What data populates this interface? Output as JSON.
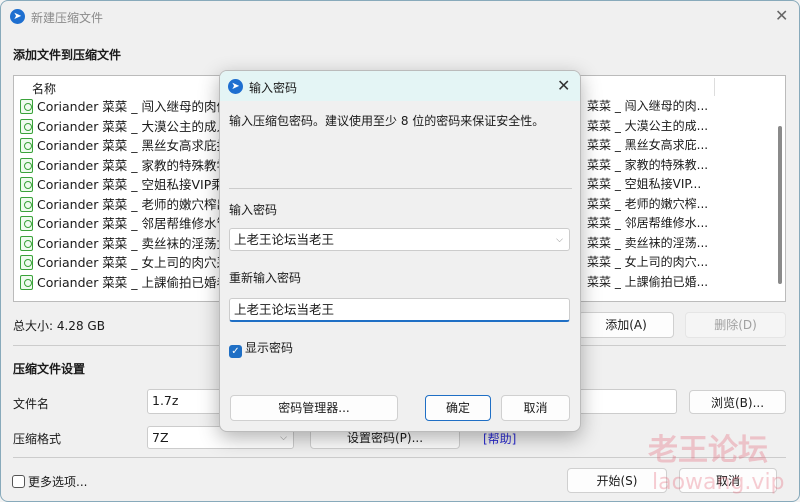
{
  "main": {
    "title": "新建压缩文件",
    "section_add": "添加文件到压缩文件",
    "column_name": "名称",
    "files": [
      {
        "name": "Coriander 菜菜 _ 闯入继母的肉体",
        "col2": "菜菜 _ 闯入继母的肉..."
      },
      {
        "name": "Coriander 菜菜 _ 大漠公主的成人",
        "col2": "菜菜 _ 大漠公主的成..."
      },
      {
        "name": "Coriander 菜菜 _ 黑丝女高求庇护",
        "col2": "菜菜 _ 黑丝女高求庇..."
      },
      {
        "name": "Coriander 菜菜 _ 家教的特殊教学",
        "col2": "菜菜 _ 家教的特殊教..."
      },
      {
        "name": "Coriander 菜菜 _ 空姐私接VIP乘客",
        "col2": "菜菜 _ 空姐私接VIP..."
      },
      {
        "name": "Coriander 菜菜 _ 老师的嫩穴榨出",
        "col2": "菜菜 _ 老师的嫩穴榨..."
      },
      {
        "name": "Coriander 菜菜 _ 邻居帮维修水管",
        "col2": "菜菜 _ 邻居帮维修水..."
      },
      {
        "name": "Coriander 菜菜 _ 卖丝袜的淫荡女",
        "col2": "菜菜 _ 卖丝袜的淫荡..."
      },
      {
        "name": "Coriander 菜菜 _ 女上司的肉穴采",
        "col2": "菜菜 _ 女上司的肉穴..."
      },
      {
        "name": "Coriander 菜菜 _ 上課偷拍已婚老",
        "col2": "菜菜 _ 上課偷拍已婚..."
      }
    ],
    "total_size": "总大小: 4.28 GB",
    "add_button": "添加(A)",
    "delete_button": "删除(D)",
    "section_settings": "压缩文件设置",
    "filename_label": "文件名",
    "filename_value": "1.7z",
    "browse_button": "浏览(B)...",
    "format_label": "压缩格式",
    "format_value": "7Z",
    "set_password_button": "设置密码(P)...",
    "help_link": "[帮助]",
    "more_options": "更多选项...",
    "start_button": "开始(S)",
    "cancel_button": "取消"
  },
  "dialog": {
    "title": "输入密码",
    "description": "输入压缩包密码。建议使用至少 8 位的密码来保证安全性。",
    "password_label": "输入密码",
    "password_value": "上老王论坛当老王",
    "reenter_label": "重新输入密码",
    "reenter_value": "上老王论坛当老王",
    "show_password": "显示密码",
    "show_password_checked": true,
    "manager_button": "密码管理器...",
    "ok_button": "确定",
    "cancel_button": "取消"
  },
  "watermark": {
    "text": "老王论坛",
    "url": "laowang.vip"
  },
  "colors": {
    "accent": "#1f6fc5",
    "dialog_title_bg": "#e4f5f5",
    "help_link": "#2b2bd0"
  }
}
